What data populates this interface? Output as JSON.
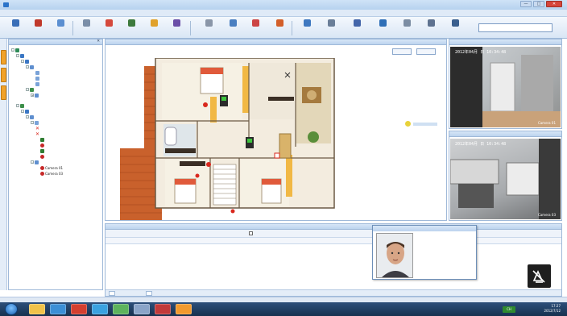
{
  "window": {
    "title": "",
    "controls": [
      "—",
      "□",
      "✕"
    ]
  },
  "menu": [
    "",
    "",
    "",
    "",
    "",
    "",
    "",
    "",
    "",
    "",
    "",
    ""
  ],
  "toolbar": {
    "buttons": [
      "",
      "",
      "",
      "",
      "",
      "",
      "",
      "",
      "",
      "",
      "",
      "",
      "",
      "",
      "",
      "",
      "",
      "",
      "",
      "",
      "",
      "",
      "",
      "",
      "",
      ""
    ],
    "split_button": ""
  },
  "tree": {
    "title": "",
    "close": "✕",
    "nodes": [
      {
        "label": ""
      },
      {
        "label": ""
      },
      {
        "label": ""
      },
      {
        "label": ""
      },
      {
        "label": ""
      },
      {
        "label": ""
      },
      {
        "label": ""
      },
      {
        "label": ""
      },
      {
        "label": ""
      },
      {
        "label": ""
      },
      {
        "label": ""
      },
      {
        "label": ""
      },
      {
        "label": ""
      },
      {
        "label": ""
      },
      {
        "label": ""
      },
      {
        "label": ""
      },
      {
        "label": ""
      },
      {
        "label": ""
      },
      {
        "label": ""
      },
      {
        "label": ""
      },
      {
        "label": "Camera 01"
      },
      {
        "label": "Camera 03"
      }
    ]
  },
  "map": {
    "breadcrumb": "",
    "btn_a": "",
    "btn_b": "",
    "labels": [
      "",
      "",
      "",
      "",
      "",
      "",
      ""
    ]
  },
  "cameras": [
    {
      "title": "",
      "osd": "2012年04月 日",
      "time": "10:34:48",
      "tag": "Camera 01"
    },
    {
      "title": "",
      "osd": "2012年04月 日",
      "time": "10:34:48",
      "tag": "Camera 03"
    }
  ],
  "events": {
    "title": "",
    "checkbox_label": "",
    "columns": [
      "",
      "",
      "",
      "",
      "",
      "",
      "",
      "",
      "",
      "",
      "",
      "",
      "",
      ""
    ],
    "tabs": [
      "",
      ""
    ]
  },
  "popup": {
    "title": "",
    "lines": [
      "",
      "",
      "",
      "",
      "",
      "",
      ""
    ]
  },
  "status": {
    "left": "",
    "items": [
      "",
      "",
      "",
      ""
    ]
  },
  "taskbar": {
    "clock_time": "17:27",
    "clock_date": "2012/7/12",
    "lang": "CH"
  },
  "colors": {
    "accent": "#2a73c9",
    "alarm": "#d9281e",
    "sidetab": "#f0a22b"
  }
}
